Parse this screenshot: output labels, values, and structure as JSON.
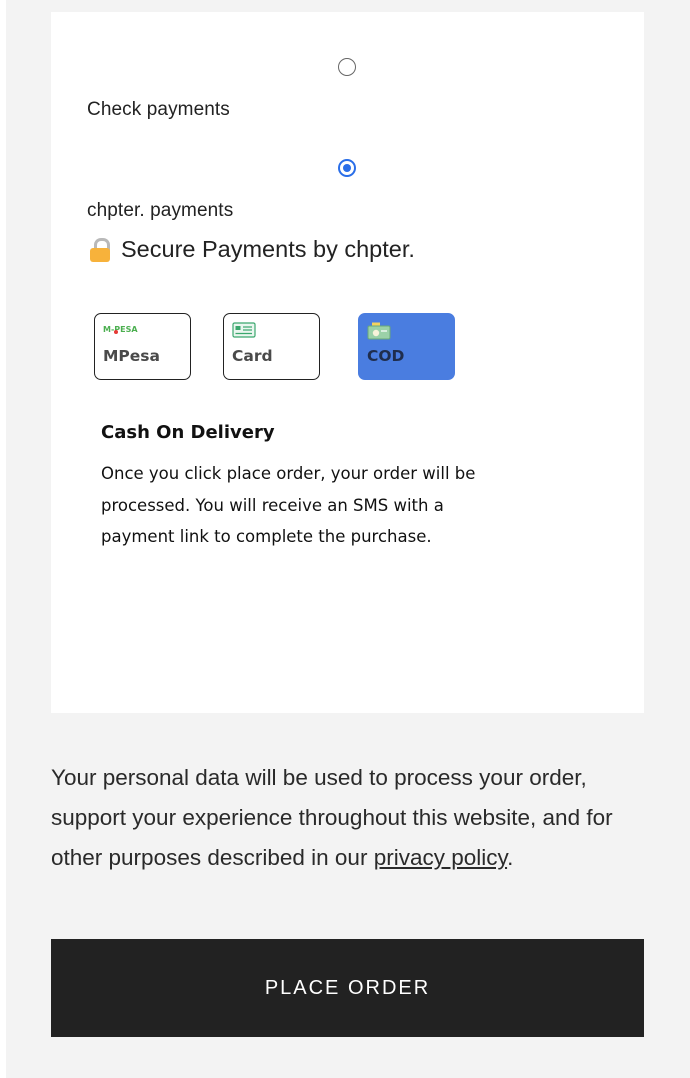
{
  "payment": {
    "methods": [
      {
        "label": "Check payments",
        "selected": false
      },
      {
        "label": "chpter. payments",
        "selected": true
      }
    ],
    "secure_text": "Secure Payments by chpter.",
    "options": [
      {
        "label": "MPesa",
        "icon": "mpesa-logo-icon",
        "icon_text": "M-PESA",
        "selected": false
      },
      {
        "label": "Card",
        "icon": "card-icon",
        "selected": false
      },
      {
        "label": "COD",
        "icon": "cash-icon",
        "selected": true
      }
    ],
    "cod": {
      "title": "Cash On Delivery",
      "description": "Once you click place order, your order will be processed. You will receive an SMS with a payment link to complete the purchase."
    }
  },
  "privacy": {
    "text": "Your personal data will be used to process your order, support your experience throughout this website, and for other purposes described in our ",
    "link_text": "privacy policy",
    "suffix": "."
  },
  "place_order_label": "PLACE ORDER",
  "colors": {
    "accent": "#4a7de0",
    "radio": "#2a6ee8",
    "button": "#222222",
    "lock": "#f7b23b"
  }
}
